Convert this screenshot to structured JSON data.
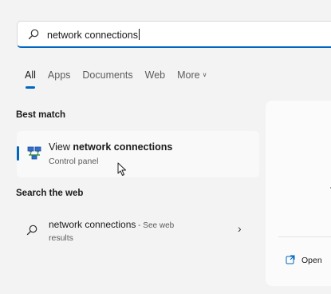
{
  "search": {
    "query": "network connections"
  },
  "tabs": [
    {
      "label": "All",
      "active": true
    },
    {
      "label": "Apps"
    },
    {
      "label": "Documents"
    },
    {
      "label": "Web"
    },
    {
      "label": "More"
    }
  ],
  "tab_more_chevron": "∨",
  "sections": {
    "best_match": "Best match",
    "search_web": "Search the web"
  },
  "best_match": {
    "title_prefix": "View ",
    "title_bold": "network connections",
    "subtitle": "Control panel",
    "icon": "network-connections-icon"
  },
  "web_result": {
    "title": "network connections",
    "title_suffix": " - See web",
    "subtitle": "results",
    "arrow": "›",
    "icon": "search-icon"
  },
  "preview": {
    "open_label": "Open",
    "open_icon": "open-external-icon"
  },
  "colors": {
    "accent": "#0067c0",
    "background": "#f3f3f3"
  }
}
